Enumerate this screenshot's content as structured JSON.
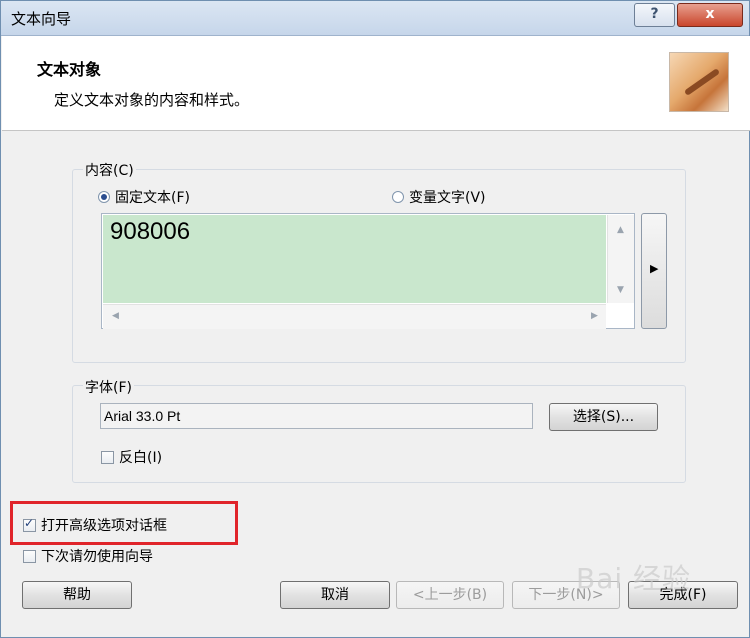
{
  "window": {
    "title": "文本向导",
    "help_btn": "?",
    "close_btn": "x"
  },
  "header": {
    "title": "文本对象",
    "description": "定义文本对象的内容和样式。"
  },
  "content_group": {
    "label": "内容(C)",
    "fixed_text_label": "固定文本(F)",
    "variable_text_label": "变量文字(V)",
    "selected": "fixed_text",
    "text_value": "908006",
    "arrow_button": "▶"
  },
  "font_group": {
    "label": "字体(F)",
    "font_value": "Arial 33.0 Pt",
    "select_button": "选择(S)...",
    "inverse_label": "反白(I)",
    "inverse_checked": false
  },
  "options": {
    "advanced_label": "打开高级选项对话框",
    "advanced_checked": true,
    "no_wizard_label": "下次请勿使用向导",
    "no_wizard_checked": false
  },
  "footer": {
    "help_button": "帮助",
    "cancel_button": "取消",
    "prev_button": "<上一步(B)",
    "next_button": "下一步(N)>",
    "finish_button": "完成(F)"
  },
  "watermark": "Bai 经验",
  "colors": {
    "text_area_fill": "#c9e7cd",
    "highlight_border": "#e0242a"
  }
}
